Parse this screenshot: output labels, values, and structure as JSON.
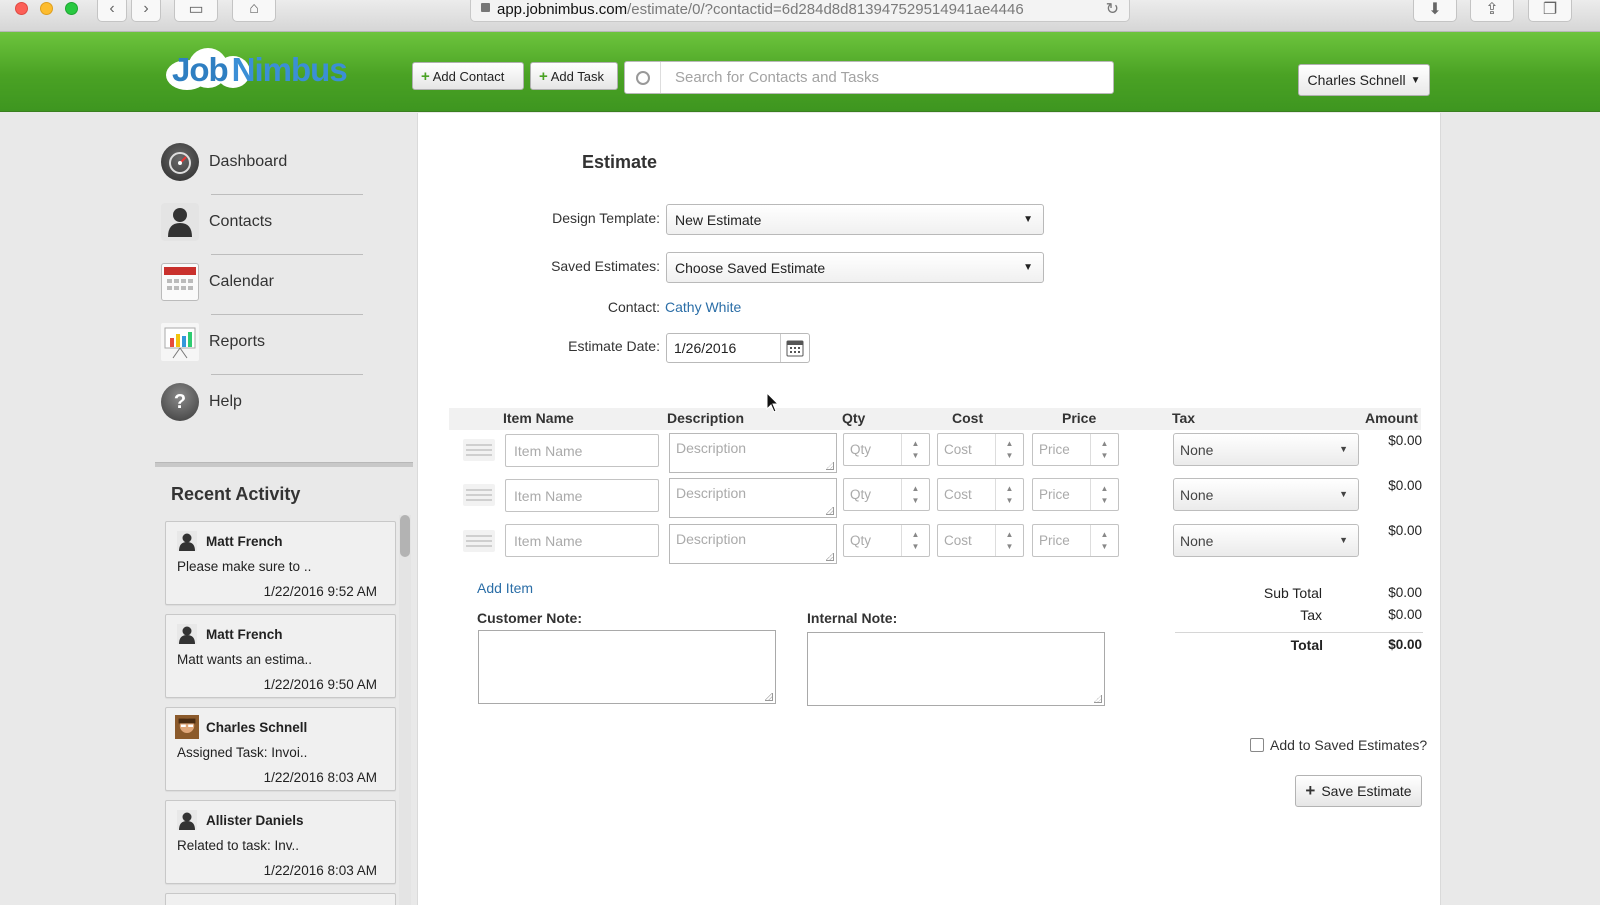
{
  "browser": {
    "url_host": "app.jobnimbus.com",
    "url_path": "/estimate/0/?contactid=6d284d8d813947529514941ae4446"
  },
  "header": {
    "logo_job": "Job",
    "logo_nimbus": "Nimbus",
    "add_contact_label": "Add Contact",
    "add_task_label": "Add Task",
    "search_placeholder": "Search for Contacts and Tasks",
    "user_name": "Charles Schnell",
    "brand_color": "#4aa224"
  },
  "sidebar": {
    "nav": [
      {
        "label": "Dashboard",
        "icon": "dashboard-gauge-icon"
      },
      {
        "label": "Contacts",
        "icon": "person-icon"
      },
      {
        "label": "Calendar",
        "icon": "calendar-icon"
      },
      {
        "label": "Reports",
        "icon": "bar-chart-icon"
      },
      {
        "label": "Help",
        "icon": "help-icon"
      }
    ],
    "recent_activity_title": "Recent Activity",
    "activities": [
      {
        "name": "Matt French",
        "text": "Please make sure to ..",
        "time": "1/22/2016 9:52 AM"
      },
      {
        "name": "Matt French",
        "text": "Matt wants an estima..",
        "time": "1/22/2016 9:50 AM"
      },
      {
        "name": "Charles Schnell",
        "text": "Assigned Task: Invoi..",
        "time": "1/22/2016 8:03 AM"
      },
      {
        "name": "Allister Daniels",
        "text": "Related to task: Inv..",
        "time": "1/22/2016 8:03 AM"
      }
    ]
  },
  "estimate": {
    "title": "Estimate",
    "design_template_label": "Design Template:",
    "design_template_value": "New Estimate",
    "saved_estimates_label": "Saved Estimates:",
    "saved_estimates_value": "Choose Saved Estimate",
    "contact_label": "Contact:",
    "contact_value": "Cathy White",
    "date_label": "Estimate Date:",
    "date_value": "1/26/2016",
    "columns": {
      "item_name": "Item Name",
      "description": "Description",
      "qty": "Qty",
      "cost": "Cost",
      "price": "Price",
      "tax": "Tax",
      "amount": "Amount"
    },
    "placeholders": {
      "item_name": "Item Name",
      "description": "Description",
      "qty": "Qty",
      "cost": "Cost",
      "price": "Price"
    },
    "rows": [
      {
        "tax": "None",
        "amount": "$0.00"
      },
      {
        "tax": "None",
        "amount": "$0.00"
      },
      {
        "tax": "None",
        "amount": "$0.00"
      }
    ],
    "add_item_label": "Add Item",
    "customer_note_label": "Customer Note:",
    "internal_note_label": "Internal Note:",
    "totals": {
      "subtotal_label": "Sub Total",
      "subtotal_value": "$0.00",
      "tax_label": "Tax",
      "tax_value": "$0.00",
      "total_label": "Total",
      "total_value": "$0.00"
    },
    "add_saved_label": "Add to Saved Estimates?",
    "save_label": "Save Estimate"
  }
}
